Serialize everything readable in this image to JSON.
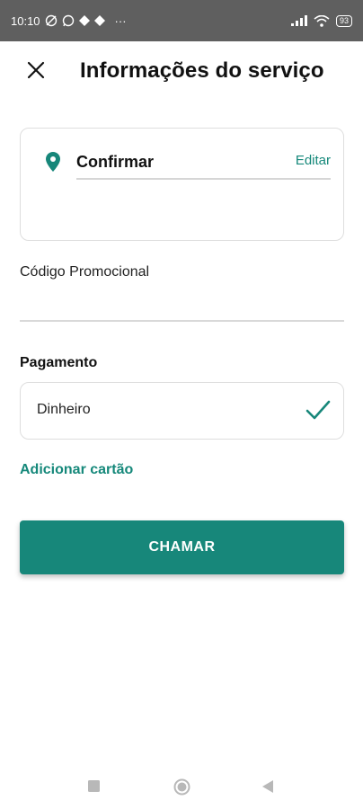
{
  "status_bar": {
    "time": "10:10",
    "dots": "···",
    "battery": "93"
  },
  "header": {
    "title": "Informações do serviço"
  },
  "address": {
    "text": "Confirmar",
    "edit_label": "Editar"
  },
  "promo": {
    "label": "Código Promocional",
    "value": ""
  },
  "payment": {
    "label": "Pagamento",
    "selected_option": "Dinheiro",
    "add_card_label": "Adicionar cartão"
  },
  "actions": {
    "call_label": "CHAMAR"
  },
  "colors": {
    "accent": "#17877a",
    "status_bar_bg": "#5f5f5f"
  },
  "icons": {
    "close": "close-icon",
    "pin": "location-pin-icon",
    "check": "check-icon",
    "nav_recent": "square-icon",
    "nav_home": "circle-icon",
    "nav_back": "triangle-icon"
  }
}
